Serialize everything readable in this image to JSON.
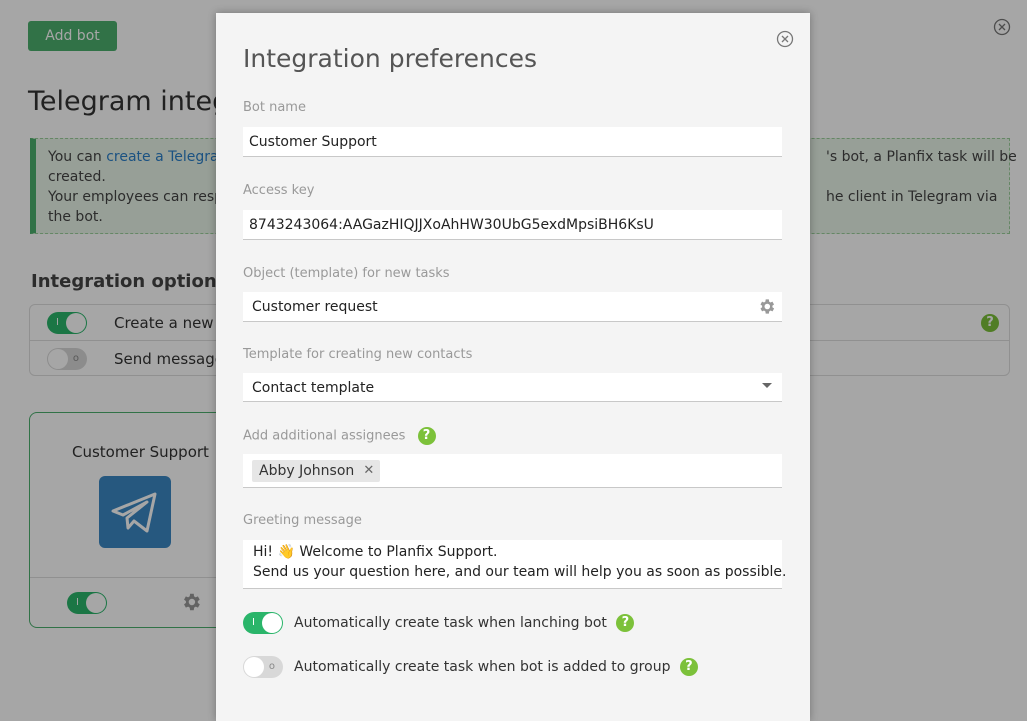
{
  "background": {
    "add_bot_label": "Add bot",
    "page_title": "Telegram integ",
    "info": {
      "l1_prefix": "You can ",
      "l1_link": "create a Telegram",
      "l1_right": "'s bot, a Planfix task will be",
      "l2": "created.",
      "l3_left": "Your employees can resp",
      "l3_right": "he client in Telegram via",
      "l4": "the bot."
    },
    "options_title": "Integration options",
    "options": [
      {
        "label": "Create a new t",
        "enabled": true
      },
      {
        "label": "Send message",
        "enabled": false
      }
    ],
    "bot_card": {
      "name": "Customer Support",
      "enabled": true
    }
  },
  "modal": {
    "title": "Integration preferences",
    "bot_name": {
      "label": "Bot name",
      "value": "Customer Support"
    },
    "access_key": {
      "label": "Access key",
      "value": "8743243064:AAGazHIQJJXoAhHW30UbG5exdMpsiBH6KsU"
    },
    "object_template": {
      "label": "Object (template) for new tasks",
      "value": "Customer request"
    },
    "contact_template": {
      "label": "Template for creating new contacts",
      "value": "Contact template"
    },
    "assignees": {
      "label": "Add additional assignees",
      "chips": [
        "Abby Johnson"
      ]
    },
    "greeting": {
      "label": "Greeting message",
      "line1": "Hi! 👋 Welcome to Planfix Support.",
      "line2": "Send us your question here, and our team will help you as soon as possible."
    },
    "auto_create_launch": {
      "label": "Automatically create task when lanching bot",
      "enabled": true
    },
    "auto_create_group": {
      "label": "Automatically create task when bot is added to group",
      "enabled": false
    }
  },
  "icons": {
    "close": "close-circle-icon",
    "gear": "gear-icon",
    "help": "help-icon",
    "telegram": "telegram-icon",
    "caret": "chevron-down-icon"
  },
  "colors": {
    "accent_green": "#2ab56a",
    "button_green": "#4caf6e",
    "help_green": "#7cc13a",
    "link_blue": "#2a7ec8",
    "telegram_blue": "#3b88c3"
  }
}
